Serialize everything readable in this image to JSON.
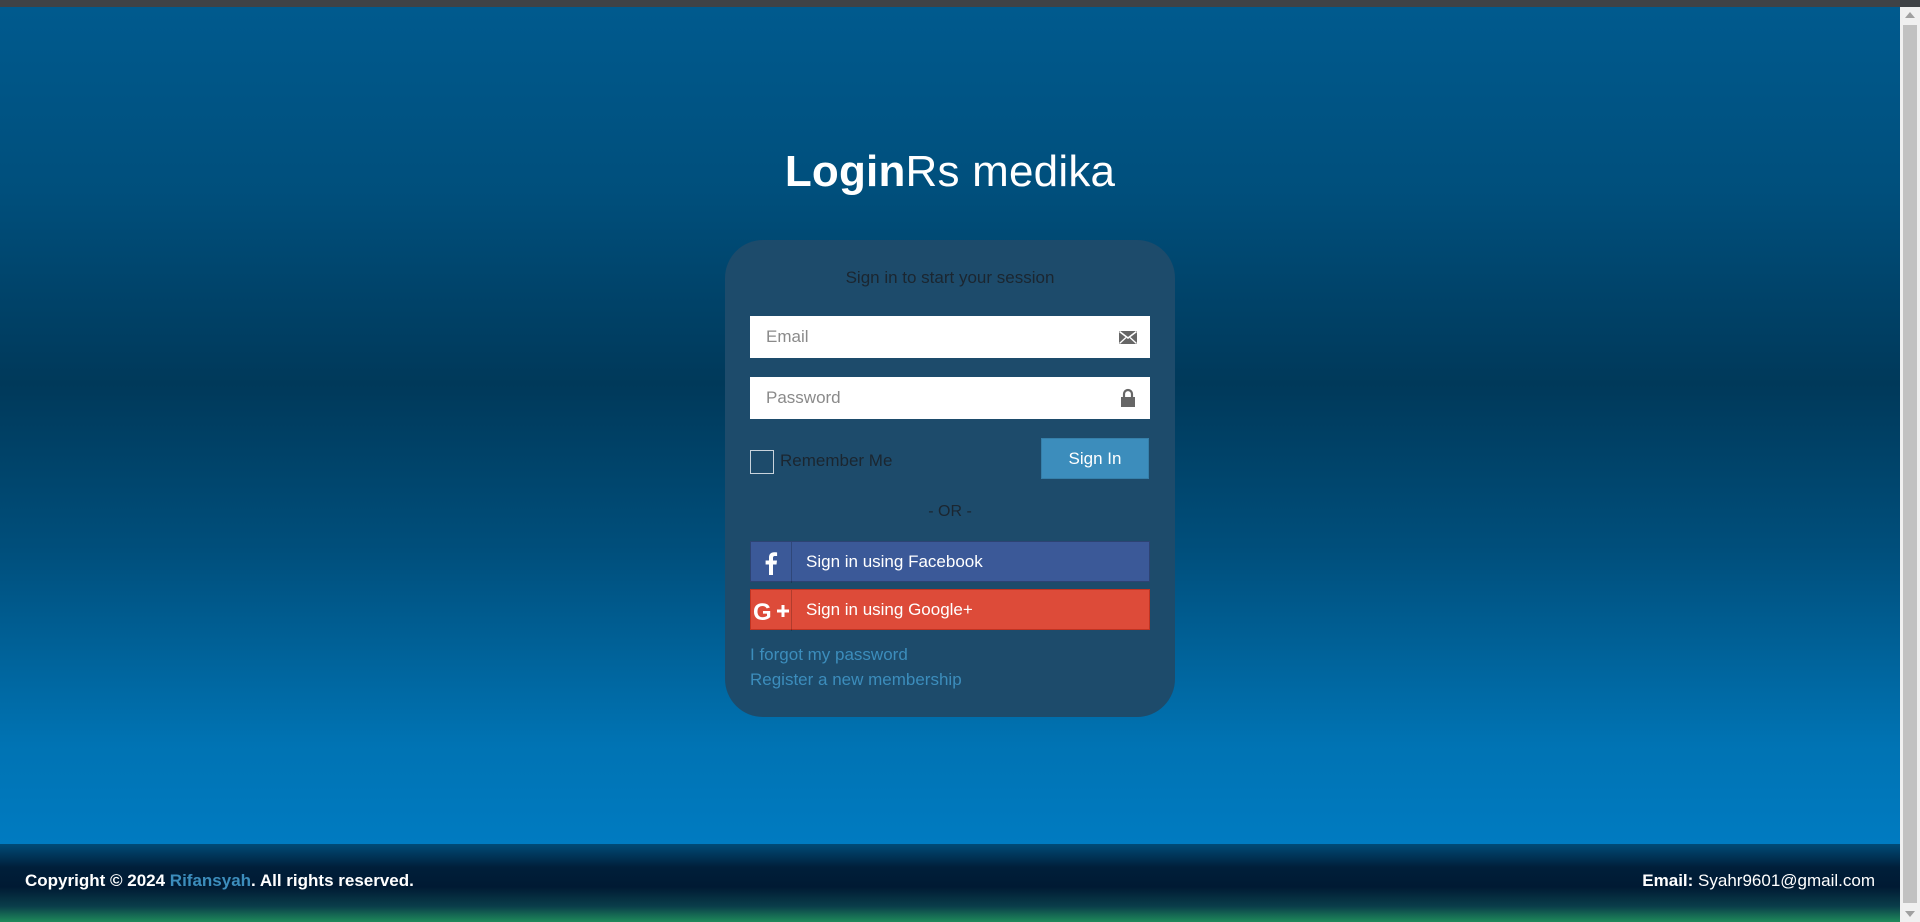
{
  "logo": {
    "bold": "Login",
    "light": "Rs medika"
  },
  "login_box": {
    "message": "Sign in to start your session",
    "email_placeholder": "Email",
    "password_placeholder": "Password",
    "remember_label": "Remember Me",
    "submit_label": "Sign In",
    "divider": "- OR -",
    "facebook_label": "Sign in using Facebook",
    "google_label": "Sign in using Google+",
    "forgot_link": "I forgot my password",
    "register_link": "Register a new membership"
  },
  "icons": {
    "email": "envelope-icon",
    "password": "lock-icon",
    "facebook": "facebook-icon",
    "google": "google-plus-icon"
  },
  "footer": {
    "copyright_prefix": "Copyright © 2024",
    "author": "Rifansyah",
    "rights": ". All rights reserved.",
    "email_label": "Email:",
    "email_value": "Syahr9601@gmail.com"
  },
  "colors": {
    "primary": "#3c8dbc",
    "facebook": "#3b5998",
    "google": "#dd4b39",
    "card": "#1d4b6b"
  }
}
